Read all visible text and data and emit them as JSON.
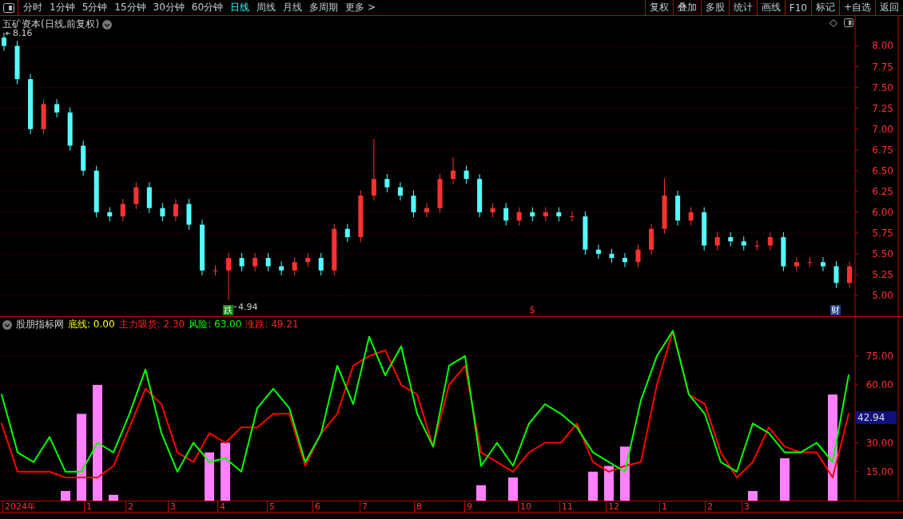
{
  "toolbar": {
    "tabs": [
      {
        "label": "分时",
        "selected": false
      },
      {
        "label": "1分钟",
        "selected": false
      },
      {
        "label": "5分钟",
        "selected": false
      },
      {
        "label": "15分钟",
        "selected": false
      },
      {
        "label": "30分钟",
        "selected": false
      },
      {
        "label": "60分钟",
        "selected": false
      },
      {
        "label": "日线",
        "selected": true
      },
      {
        "label": "周线",
        "selected": false
      },
      {
        "label": "月线",
        "selected": false
      },
      {
        "label": "多周期",
        "selected": false
      },
      {
        "label": "更多 >",
        "selected": false
      }
    ],
    "buttons": [
      "复权",
      "叠加",
      "多股",
      "统计",
      "画线",
      "F10",
      "标记",
      "+自选",
      "返回"
    ]
  },
  "price_panel": {
    "title": "五矿资本(日线,前复权)",
    "chart_data": {
      "type": "candlestick",
      "grid": true,
      "ylim": [
        4.75,
        8.36
      ],
      "yticks": [
        {
          "value": 8,
          "label": "8.00"
        },
        {
          "value": 7.75,
          "label": "7.75"
        },
        {
          "value": 7.5,
          "label": "7.50"
        },
        {
          "value": 7.25,
          "label": "7.25"
        },
        {
          "value": 7,
          "label": "7.00"
        },
        {
          "value": 6.75,
          "label": "6.75"
        },
        {
          "value": 6.5,
          "label": "6.50"
        },
        {
          "value": 6.25,
          "label": "6.25"
        },
        {
          "value": 6,
          "label": "6.00"
        },
        {
          "value": 5.75,
          "label": "5.75"
        },
        {
          "value": 5.5,
          "label": "5.50"
        },
        {
          "value": 5.25,
          "label": "5.25"
        },
        {
          "value": 5,
          "label": "5.00"
        }
      ],
      "ohlc": [
        [
          8.1,
          8.16,
          7.94,
          8.0
        ],
        [
          8.0,
          8.06,
          7.54,
          7.6
        ],
        [
          7.6,
          7.66,
          6.94,
          7.0
        ],
        [
          7.0,
          7.36,
          6.94,
          7.3
        ],
        [
          7.3,
          7.36,
          7.14,
          7.2
        ],
        [
          7.2,
          7.26,
          6.74,
          6.8
        ],
        [
          6.8,
          6.86,
          6.44,
          6.5
        ],
        [
          6.5,
          6.56,
          5.94,
          6.0
        ],
        [
          6.0,
          6.06,
          5.89,
          5.95
        ],
        [
          5.95,
          6.16,
          5.89,
          6.1
        ],
        [
          6.1,
          6.36,
          6.04,
          6.3
        ],
        [
          6.3,
          6.36,
          5.99,
          6.05
        ],
        [
          6.05,
          6.11,
          5.89,
          5.95
        ],
        [
          5.95,
          6.16,
          5.89,
          6.1
        ],
        [
          6.1,
          6.16,
          5.79,
          5.85
        ],
        [
          5.85,
          5.91,
          5.24,
          5.3
        ],
        [
          5.3,
          5.36,
          5.24,
          5.3
        ],
        [
          5.3,
          5.51,
          4.94,
          5.45
        ],
        [
          5.45,
          5.51,
          5.29,
          5.35
        ],
        [
          5.35,
          5.51,
          5.29,
          5.45
        ],
        [
          5.45,
          5.51,
          5.29,
          5.35
        ],
        [
          5.35,
          5.41,
          5.24,
          5.3
        ],
        [
          5.3,
          5.46,
          5.24,
          5.4
        ],
        [
          5.4,
          5.51,
          5.34,
          5.45
        ],
        [
          5.45,
          5.51,
          5.24,
          5.3
        ],
        [
          5.3,
          5.86,
          5.24,
          5.8
        ],
        [
          5.8,
          5.86,
          5.64,
          5.7
        ],
        [
          5.7,
          6.26,
          5.64,
          6.2
        ],
        [
          6.2,
          6.88,
          6.14,
          6.4
        ],
        [
          6.4,
          6.46,
          6.24,
          6.3
        ],
        [
          6.3,
          6.36,
          6.14,
          6.2
        ],
        [
          6.2,
          6.26,
          5.94,
          6.0
        ],
        [
          6.0,
          6.11,
          5.94,
          6.05
        ],
        [
          6.05,
          6.46,
          5.99,
          6.4
        ],
        [
          6.4,
          6.66,
          6.34,
          6.5
        ],
        [
          6.5,
          6.56,
          6.34,
          6.4
        ],
        [
          6.4,
          6.46,
          5.94,
          6.0
        ],
        [
          6.0,
          6.11,
          5.94,
          6.05
        ],
        [
          6.05,
          6.11,
          5.84,
          5.9
        ],
        [
          5.9,
          6.06,
          5.84,
          6.0
        ],
        [
          6.0,
          6.06,
          5.89,
          5.95
        ],
        [
          5.95,
          6.06,
          5.89,
          6.0
        ],
        [
          6.0,
          6.06,
          5.89,
          5.95
        ],
        [
          5.95,
          6.01,
          5.89,
          5.95
        ],
        [
          5.95,
          6.01,
          5.49,
          5.55
        ],
        [
          5.55,
          5.61,
          5.44,
          5.5
        ],
        [
          5.5,
          5.56,
          5.39,
          5.45
        ],
        [
          5.45,
          5.51,
          5.34,
          5.4
        ],
        [
          5.4,
          5.61,
          5.34,
          5.55
        ],
        [
          5.55,
          5.86,
          5.49,
          5.8
        ],
        [
          5.8,
          6.41,
          5.74,
          6.2
        ],
        [
          6.2,
          6.26,
          5.84,
          5.9
        ],
        [
          5.9,
          6.06,
          5.84,
          6.0
        ],
        [
          6.0,
          6.06,
          5.54,
          5.6
        ],
        [
          5.6,
          5.76,
          5.54,
          5.7
        ],
        [
          5.7,
          5.76,
          5.59,
          5.65
        ],
        [
          5.65,
          5.71,
          5.54,
          5.6
        ],
        [
          5.6,
          5.66,
          5.54,
          5.6
        ],
        [
          5.6,
          5.76,
          5.54,
          5.7
        ],
        [
          5.7,
          5.76,
          5.29,
          5.35
        ],
        [
          5.35,
          5.46,
          5.29,
          5.4
        ],
        [
          5.4,
          5.46,
          5.34,
          5.4
        ],
        [
          5.4,
          5.46,
          5.29,
          5.35
        ],
        [
          5.35,
          5.41,
          5.09,
          5.15
        ],
        [
          5.15,
          5.41,
          5.09,
          5.35
        ]
      ],
      "annotations": [
        "8.16",
        "4.94"
      ]
    },
    "event_markers": [
      {
        "text": "跌",
        "kind": "badge",
        "color": "#008a00"
      },
      {
        "text": "$",
        "kind": "symbol",
        "color": "#ff2020"
      },
      {
        "text": "财",
        "kind": "badge",
        "color": "#1f3f8f"
      }
    ]
  },
  "indicator_panel": {
    "name": "股朋指标网",
    "legend": [
      {
        "label": "底线:",
        "value": "0.00",
        "color": "#ffff00"
      },
      {
        "label": "主力吸货:",
        "value": "2.30",
        "color": "#ff2020"
      },
      {
        "label": "风险:",
        "value": "63.00",
        "color": "#00ff00"
      },
      {
        "label": "涨跌:",
        "value": "49.21",
        "color": "#ff2020"
      }
    ],
    "current_value": "42.94",
    "chart_data": {
      "type": "line",
      "grid": true,
      "ylim": [
        0,
        95.2
      ],
      "yticks": [
        {
          "value": 75,
          "label": "75.00"
        },
        {
          "value": 60,
          "label": "60.00"
        },
        {
          "value": 30,
          "label": "30.00"
        },
        {
          "value": 15,
          "label": "15.00"
        }
      ],
      "series": [
        {
          "type": "line",
          "color": "#00ff00",
          "values": [
            55,
            25,
            20,
            33,
            15,
            15,
            30,
            25,
            45,
            68,
            35,
            15,
            30,
            20,
            22,
            15,
            48,
            58,
            48,
            20,
            35,
            70,
            50,
            85,
            65,
            80,
            45,
            28,
            70,
            75,
            18,
            30,
            18,
            40,
            50,
            45,
            38,
            25,
            20,
            15,
            52,
            75,
            88,
            55,
            45,
            20,
            15,
            40,
            35,
            25,
            25,
            30,
            20,
            65
          ]
        },
        {
          "type": "line",
          "color": "#ff0000",
          "values": [
            40,
            15,
            15,
            15,
            12,
            12,
            12,
            18,
            38,
            58,
            50,
            25,
            20,
            35,
            30,
            38,
            38,
            45,
            45,
            18,
            35,
            45,
            70,
            75,
            78,
            60,
            55,
            28,
            60,
            70,
            25,
            20,
            15,
            25,
            30,
            30,
            40,
            20,
            15,
            18,
            20,
            60,
            88,
            55,
            50,
            25,
            12,
            20,
            38,
            28,
            25,
            25,
            12,
            45
          ]
        },
        {
          "type": "bar",
          "color": "#ff80ff",
          "values": [
            0,
            0,
            0,
            0,
            5,
            45,
            60,
            3,
            0,
            0,
            0,
            0,
            0,
            25,
            30,
            0,
            0,
            0,
            0,
            0,
            0,
            0,
            0,
            0,
            0,
            0,
            0,
            0,
            0,
            0,
            8,
            0,
            12,
            0,
            0,
            0,
            0,
            15,
            18,
            28,
            0,
            0,
            0,
            0,
            0,
            0,
            0,
            5,
            0,
            22,
            0,
            0,
            55,
            0
          ]
        }
      ]
    }
  },
  "x_axis": {
    "xticks": [
      "2024年",
      "1",
      "2",
      "3",
      "4",
      "5",
      "6",
      "7",
      "8",
      "9",
      "10",
      "11",
      "12",
      "1",
      "2",
      "3"
    ]
  }
}
